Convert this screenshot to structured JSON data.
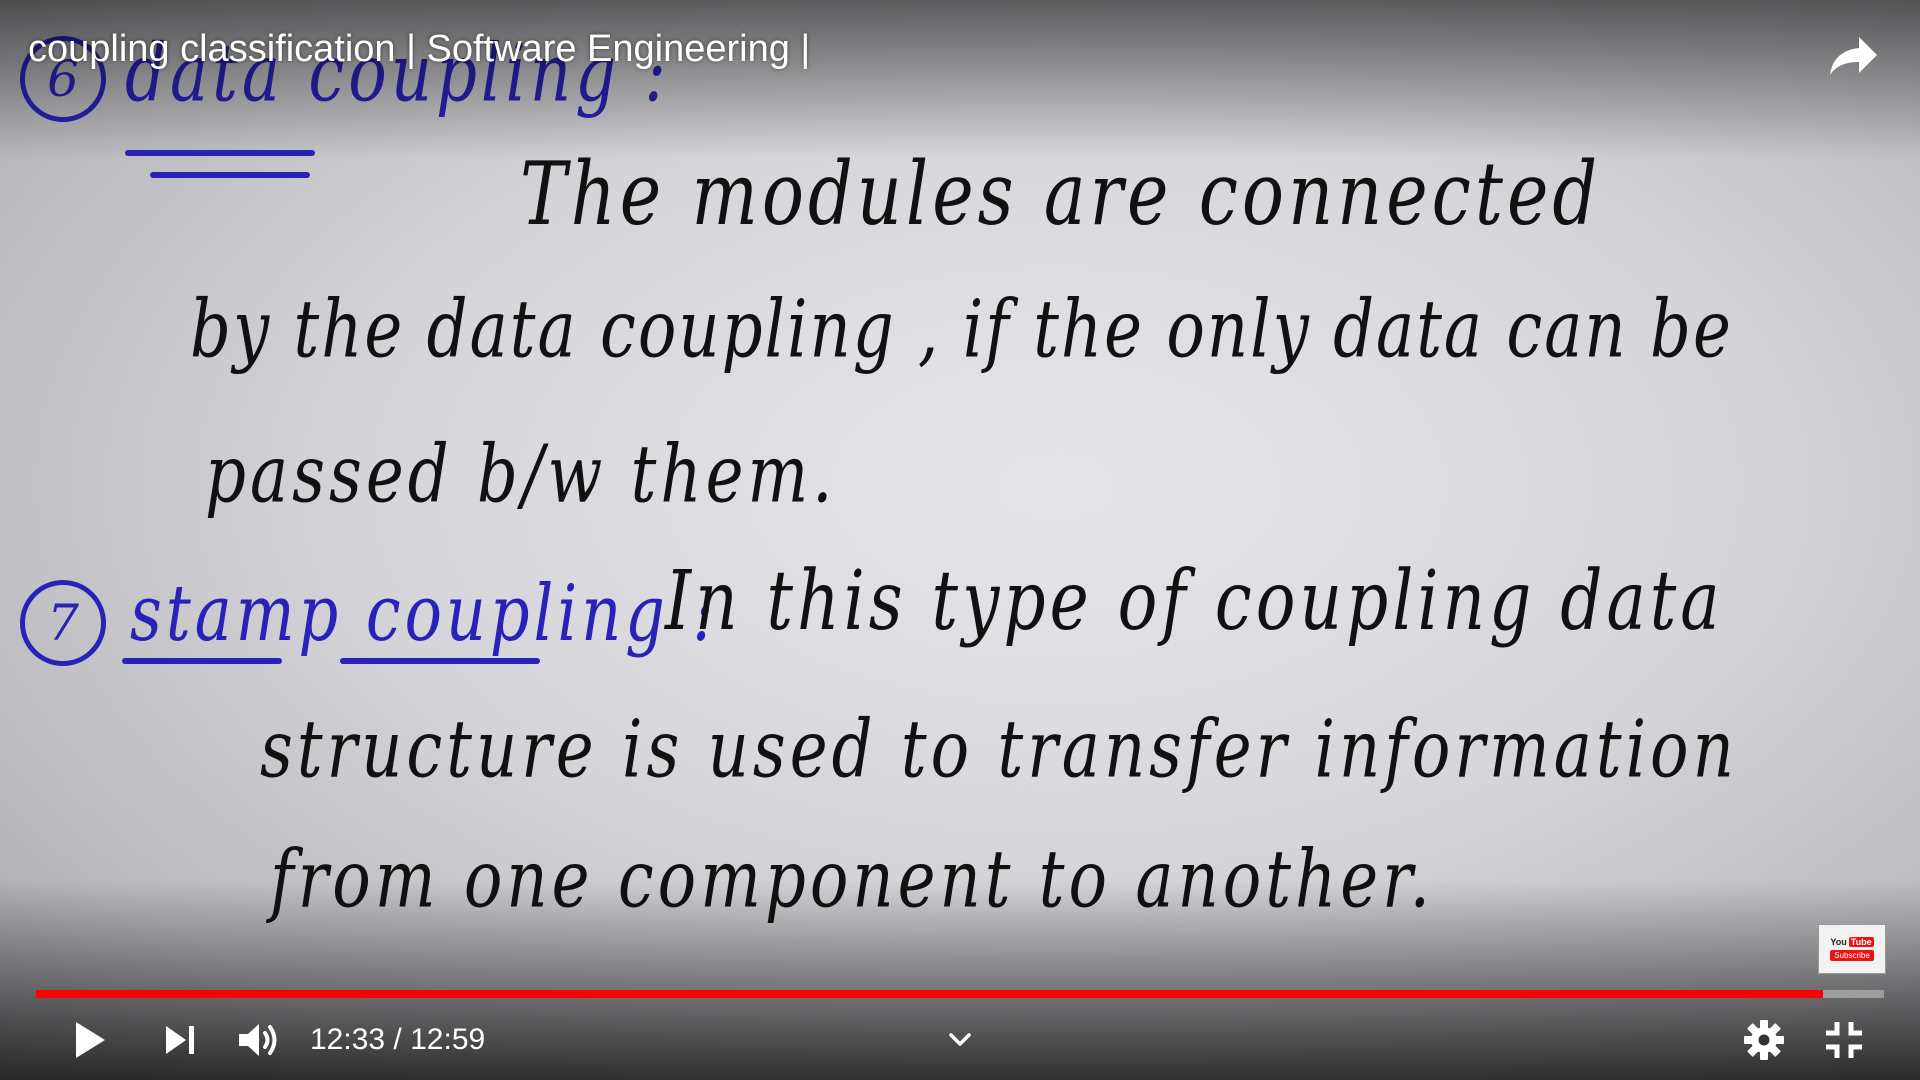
{
  "video": {
    "title": "coupling classification | Software Engineering |",
    "current_time": "12:33",
    "separator": "/",
    "duration": "12:59",
    "progress_fraction": 0.967
  },
  "board": {
    "item6_number": "6",
    "item6_heading": "data coupling :",
    "item6_line1": "The modules are connected",
    "item6_line2": "by the data coupling , if the only data can be",
    "item6_line3": "passed b/w them.",
    "item7_number": "7",
    "item7_heading": "stamp coupling :",
    "item7_line1": "In this type of coupling data",
    "item7_line2": "structure is used to transfer information",
    "item7_line3": "from one component to another."
  },
  "subscribe": {
    "logo_you": "You",
    "logo_tube": "Tube",
    "button": "Subscribe"
  },
  "colors": {
    "progress": "#ff0000",
    "marker_blue": "#2a22b8",
    "ink_black": "#111111"
  },
  "icons": {
    "share": "share-icon",
    "play": "play-icon",
    "next": "next-icon",
    "volume": "volume-icon",
    "chevron": "chevron-down-icon",
    "settings": "gear-icon",
    "exit_fullscreen": "exit-fullscreen-icon"
  }
}
